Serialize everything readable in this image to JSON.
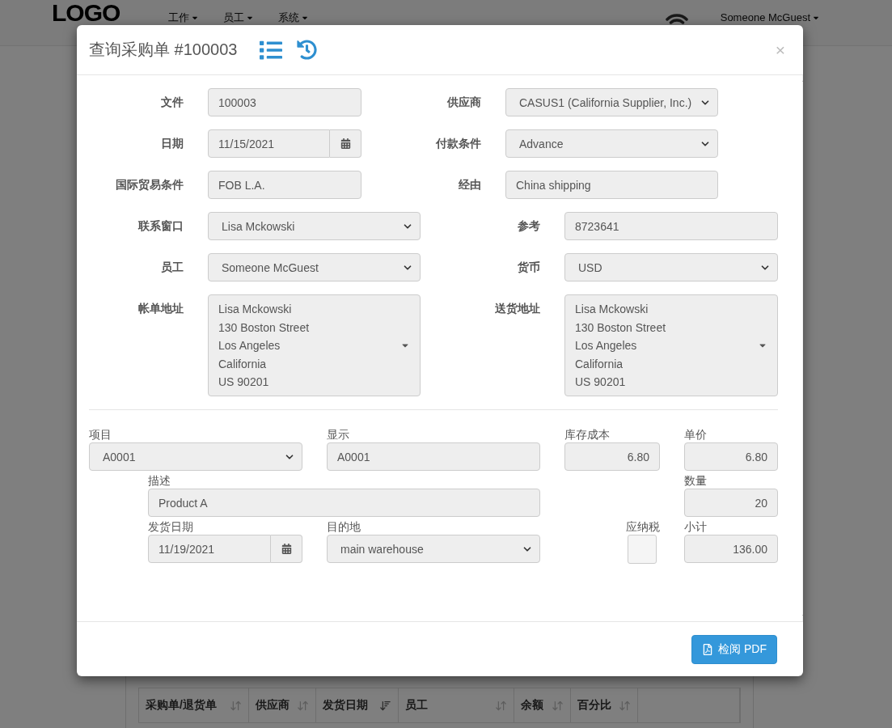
{
  "nav": {
    "logo": "LOGO",
    "menus": [
      {
        "label": "工作"
      },
      {
        "label": "员工"
      },
      {
        "label": "系统"
      }
    ],
    "user": "Someone McGuest"
  },
  "background_table": {
    "columns": [
      {
        "label": "采购单/退货单",
        "sorted": false
      },
      {
        "label": "供应商",
        "sorted": false
      },
      {
        "label": "发货日期",
        "sorted": true
      },
      {
        "label": "员工",
        "sorted": false
      },
      {
        "label": "余额",
        "sorted": false
      },
      {
        "label": "百分比",
        "sorted": false
      }
    ]
  },
  "modal": {
    "title": "查询采购单 #100003",
    "close": "×",
    "header_rows": [
      {
        "kind": "compact",
        "left": {
          "label": "文件",
          "kind": "text",
          "value": "100003"
        },
        "right": {
          "label": "供应商",
          "kind": "select",
          "value": "CASUS1 (California Supplier, Inc.)"
        }
      },
      {
        "kind": "compact",
        "left": {
          "label": "日期",
          "kind": "date",
          "value": "11/15/2021"
        },
        "right": {
          "label": "付款条件",
          "kind": "select",
          "value": "Advance"
        }
      },
      {
        "kind": "compact",
        "left": {
          "label": "国际贸易条件",
          "kind": "text",
          "value": "FOB L.A."
        },
        "right": {
          "label": "经由",
          "kind": "text",
          "value": "China shipping"
        }
      },
      {
        "kind": "full",
        "left": {
          "label": "联系窗口",
          "kind": "select",
          "value": "Lisa Mckowski"
        },
        "right": {
          "label": "参考",
          "kind": "text",
          "value": "8723641"
        }
      },
      {
        "kind": "full",
        "left": {
          "label": "员工",
          "kind": "select",
          "value": "Someone McGuest"
        },
        "right": {
          "label": "货币",
          "kind": "select",
          "value": "USD"
        }
      },
      {
        "kind": "full",
        "left": {
          "label": "帐单地址",
          "kind": "address",
          "lines": [
            "Lisa Mckowski",
            "130 Boston Street",
            "Los Angeles",
            "California",
            "US 90201"
          ]
        },
        "right": {
          "label": "送货地址",
          "kind": "address",
          "lines": [
            "Lisa Mckowski",
            "130 Boston Street",
            "Los Angeles",
            "California",
            "US 90201"
          ]
        }
      }
    ],
    "line_item": [
      {
        "label": "项目",
        "kind": "select",
        "value": "A0001"
      },
      {
        "label": "显示",
        "kind": "text",
        "value": "A0001"
      },
      {
        "label": "库存成本",
        "kind": "number",
        "value": "6.80"
      },
      {
        "label": "单价",
        "kind": "number",
        "value": "6.80"
      },
      {
        "label": "描述",
        "kind": "text",
        "value": "Product A"
      },
      {
        "label": "数量",
        "kind": "number",
        "value": "20"
      },
      {
        "label": "发货日期",
        "kind": "date",
        "value": "11/19/2021"
      },
      {
        "label": "目的地",
        "kind": "select",
        "value": "main warehouse"
      },
      {
        "label": "应纳税",
        "kind": "checkbox",
        "checked": false
      },
      {
        "label": "小计",
        "kind": "number",
        "value": "136.00"
      }
    ],
    "footer_button": "检阅 PDF"
  }
}
